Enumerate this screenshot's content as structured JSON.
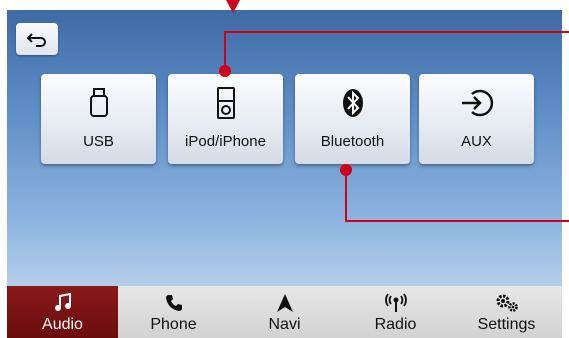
{
  "header": {
    "back_icon": "back-arrow-icon"
  },
  "sources": [
    {
      "label": "USB",
      "icon": "usb-icon"
    },
    {
      "label": "iPod/iPhone",
      "icon": "ipod-icon"
    },
    {
      "label": "Bluetooth",
      "icon": "bluetooth-icon"
    },
    {
      "label": "AUX",
      "icon": "aux-input-icon"
    }
  ],
  "tabs": [
    {
      "label": "Audio",
      "icon": "music-note-icon",
      "active": true
    },
    {
      "label": "Phone",
      "icon": "phone-icon",
      "active": false
    },
    {
      "label": "Navi",
      "icon": "navigation-arrow-icon",
      "active": false
    },
    {
      "label": "Radio",
      "icon": "radio-signal-icon",
      "active": false
    },
    {
      "label": "Settings",
      "icon": "gears-icon",
      "active": false
    }
  ],
  "colors": {
    "accent": "#d0021b",
    "active_tab": "#7a1010",
    "screen_top": "#3e6ba6",
    "screen_bottom": "#c9dcef"
  }
}
